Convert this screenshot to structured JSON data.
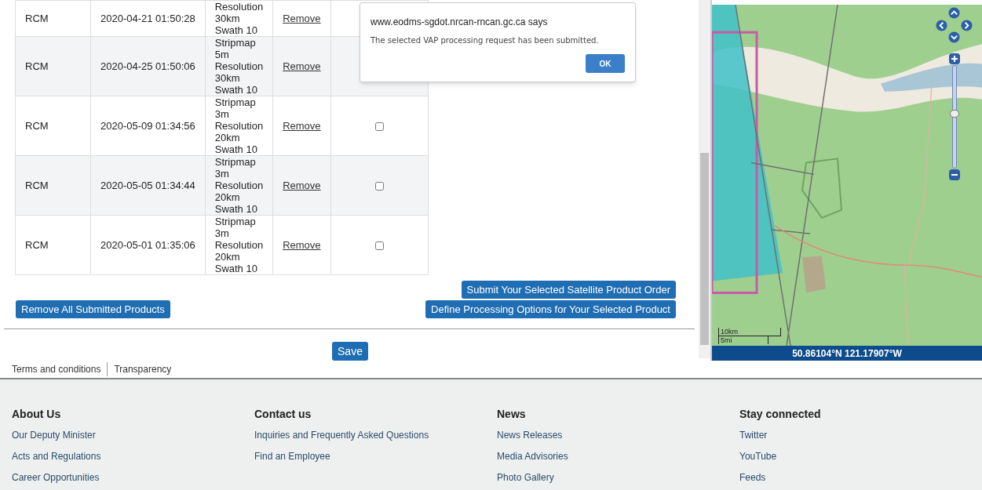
{
  "table": {
    "rows": [
      {
        "product": "RCM",
        "date": "2020-04-21 01:50:28",
        "description": [
          "Resolution",
          "30km",
          "Swath 10"
        ],
        "action": "Remove"
      },
      {
        "product": "RCM",
        "date": "2020-04-25 01:50:06",
        "description": [
          "Stripmap",
          "5m",
          "Resolution",
          "30km",
          "Swath 10"
        ],
        "action": "Remove"
      },
      {
        "product": "RCM",
        "date": "2020-05-09 01:34:56",
        "description": [
          "Stripmap",
          "3m",
          "Resolution",
          "20km",
          "Swath 10"
        ],
        "action": "Remove",
        "checked": false
      },
      {
        "product": "RCM",
        "date": "2020-05-05 01:34:44",
        "description": [
          "Stripmap",
          "3m",
          "Resolution",
          "20km",
          "Swath 10"
        ],
        "action": "Remove",
        "checked": false
      },
      {
        "product": "RCM",
        "date": "2020-05-01 01:35:06",
        "description": [
          "Stripmap",
          "3m",
          "Resolution",
          "20km",
          "Swath 10"
        ],
        "action": "Remove",
        "checked": false
      }
    ]
  },
  "dialog": {
    "title": "www.eodms-sgdot.nrcan-rncan.gc.ca says",
    "message": "The selected VAP processing request has been submitted.",
    "button": "OK"
  },
  "buttons": {
    "submit": "Submit Your Selected Satellite Product Order",
    "define": "Define Processing Options for Your Selected Product",
    "remove_all": "Remove All Submitted Products",
    "save": "Save"
  },
  "map": {
    "scale": [
      "10km",
      "5mi"
    ],
    "coordinates": "50.86104°N 121.17907°W",
    "zoom": {
      "level": 0.54
    }
  },
  "footer_links": [
    "Terms and conditions",
    "Transparency"
  ],
  "footer": {
    "columns": [
      {
        "heading": "About Us",
        "links": [
          "Our Deputy Minister",
          "Acts and Regulations",
          "Career Opportunities"
        ]
      },
      {
        "heading": "Contact us",
        "links": [
          "Inquiries and Frequently Asked Questions",
          "Find an Employee"
        ]
      },
      {
        "heading": "News",
        "links": [
          "News Releases",
          "Media Advisories",
          "Photo Gallery"
        ]
      },
      {
        "heading": "Stay connected",
        "links": [
          "Twitter",
          "YouTube",
          "Feeds"
        ]
      }
    ]
  }
}
